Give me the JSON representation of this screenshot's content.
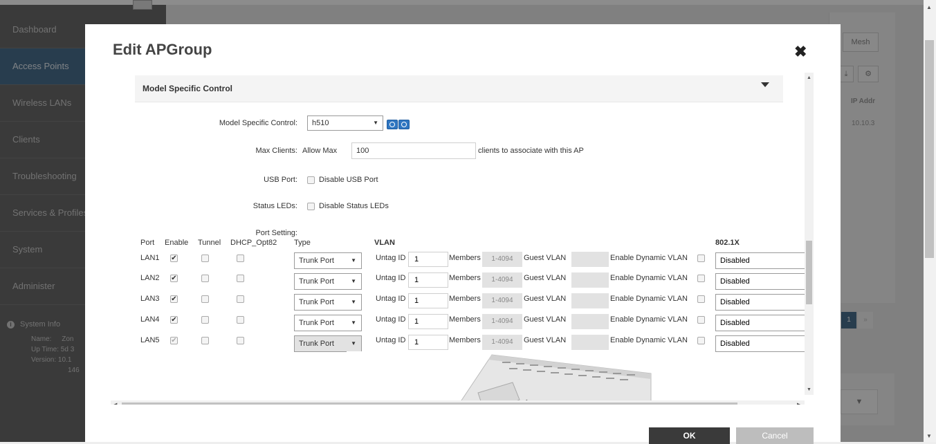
{
  "sidebar": {
    "items": [
      {
        "label": "Dashboard"
      },
      {
        "label": "Access Points"
      },
      {
        "label": "Wireless LANs"
      },
      {
        "label": "Clients"
      },
      {
        "label": "Troubleshooting"
      },
      {
        "label": "Services & Profiles"
      },
      {
        "label": "System"
      },
      {
        "label": "Administer"
      }
    ],
    "system_info": {
      "title": "System Info",
      "name_label": "Name:",
      "name_value": "Zon",
      "uptime_label": "Up Time:",
      "uptime_value": "5d 3",
      "version_label": "Version:",
      "version_value": "10.1",
      "version_extra": "146"
    }
  },
  "background": {
    "mesh_label": "Mesh",
    "download_icon": "⤓",
    "gear_icon": "⚙",
    "ip_header": "IP Addr",
    "ip_value": "10.10.3",
    "page_current": "1",
    "page_next": "»",
    "dropdown_caret": "▼"
  },
  "modal": {
    "title": "Edit APGroup",
    "close": "✖",
    "section_title": "Model Specific Control",
    "fields": {
      "model_label": "Model Specific Control:",
      "model_value": "h510",
      "max_clients_label": "Max Clients:",
      "allow_max": "Allow Max",
      "max_clients_value": "100",
      "clients_suffix": "clients to associate with this AP",
      "usb_label": "USB Port:",
      "usb_option": "Disable USB Port",
      "led_label": "Status LEDs:",
      "led_option": "Disable Status LEDs",
      "port_setting_label": "Port Setting:"
    },
    "table_headers": {
      "port": "Port",
      "enable": "Enable",
      "tunnel": "Tunnel",
      "dhcp": "DHCP_Opt82",
      "type": "Type",
      "vlan": "VLAN",
      "dot1x": "802.1X"
    },
    "rows": [
      {
        "port": "LAN1",
        "type": "Trunk Port",
        "untag_label": "Untag ID",
        "untag": "1",
        "members_label": "Members",
        "members": "1-4094",
        "guest_label": "Guest VLAN",
        "dynamic_label": "Enable Dynamic VLAN",
        "dot1x": "Disabled"
      },
      {
        "port": "LAN2",
        "type": "Trunk Port",
        "untag_label": "Untag ID",
        "untag": "1",
        "members_label": "Members",
        "members": "1-4094",
        "guest_label": "Guest VLAN",
        "dynamic_label": "Enable Dynamic VLAN",
        "dot1x": "Disabled"
      },
      {
        "port": "LAN3",
        "type": "Trunk Port",
        "untag_label": "Untag ID",
        "untag": "1",
        "members_label": "Members",
        "members": "1-4094",
        "guest_label": "Guest VLAN",
        "dynamic_label": "Enable Dynamic VLAN",
        "dot1x": "Disabled"
      },
      {
        "port": "LAN4",
        "type": "Trunk Port",
        "untag_label": "Untag ID",
        "untag": "1",
        "members_label": "Members",
        "members": "1-4094",
        "guest_label": "Guest VLAN",
        "dynamic_label": "Enable Dynamic VLAN",
        "dot1x": "Disabled"
      },
      {
        "port": "LAN5",
        "type": "Trunk Port",
        "untag_label": "Untag ID",
        "untag": "1",
        "members_label": "Members",
        "members": "1-4094",
        "guest_label": "Guest VLAN",
        "dynamic_label": "Enable Dynamic VLAN",
        "dot1x": "Disabled"
      }
    ],
    "ok_label": "OK",
    "cancel_label": "Cancel",
    "checkmark": "✔",
    "caret": "▼"
  },
  "colors": {
    "sidebar_bg": "#6a6a6a",
    "sidebar_active": "#4a6f8f",
    "ok_button": "#3a3a3a",
    "cancel_button": "#bdbdbd",
    "mini_button": "#2f76c1"
  }
}
